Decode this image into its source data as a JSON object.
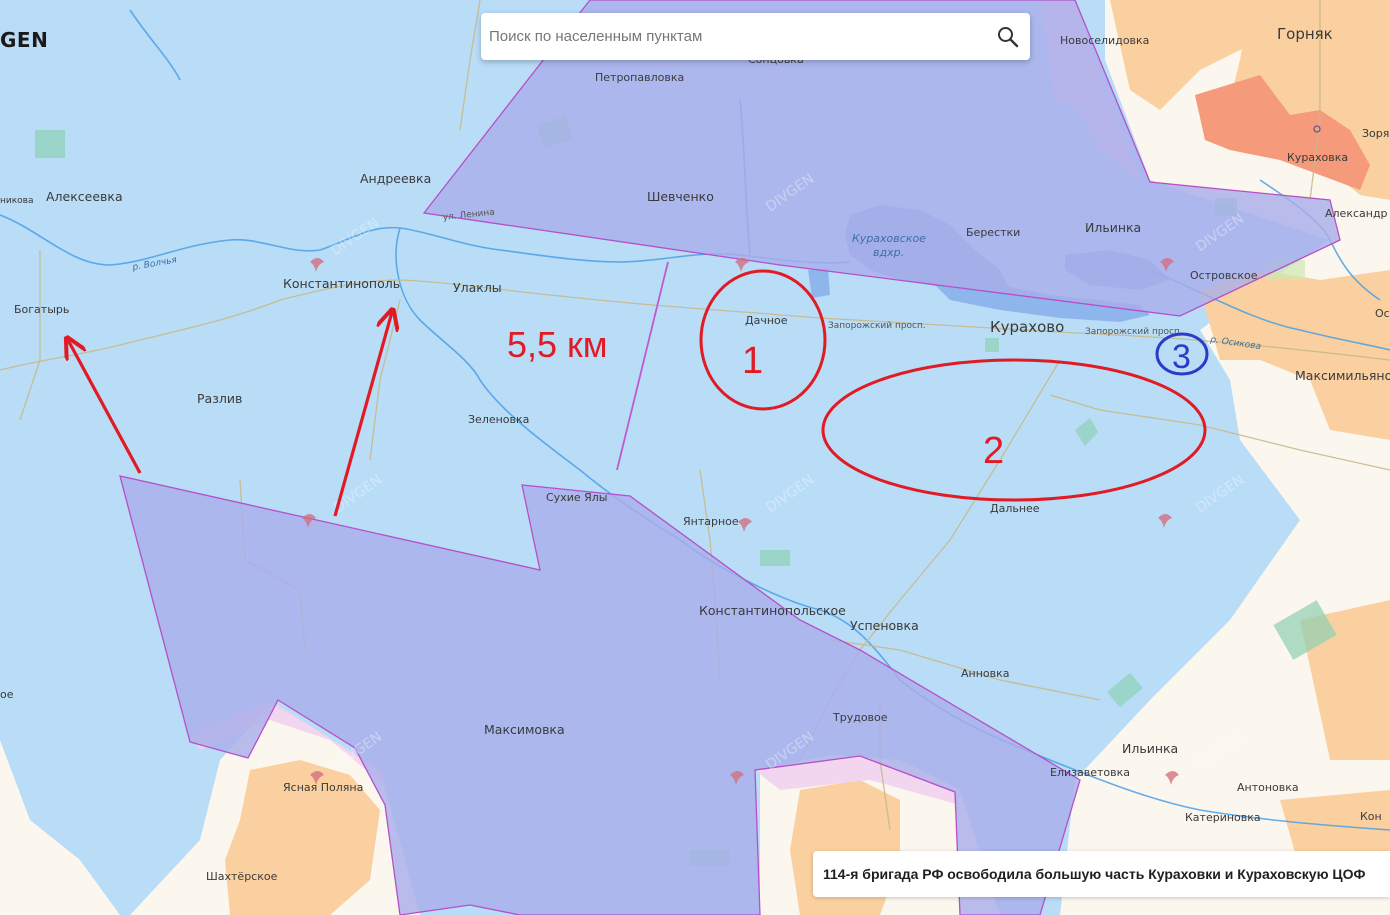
{
  "brand": {
    "logo_text": "GEN"
  },
  "search": {
    "placeholder": "Поиск по населенным пунктам",
    "icon": "search-icon"
  },
  "news": {
    "headline": "114-я бригада РФ освободила большую часть Кураховки и Кураховскую ЦОФ"
  },
  "annotations": {
    "distance": "5,5 км",
    "zone_1": "1",
    "zone_2": "2",
    "zone_3": "3",
    "annotation_color": "#e01b24",
    "marker_color": "#2a3dc9"
  },
  "colors": {
    "background_zone": "#b9dcf7",
    "occupied_zone": "#a9aeea",
    "border_line": "#b64fc9",
    "town_fill": "#fbd0a0",
    "contested_fill": "#f59a7a",
    "neutral_land": "#fbf6ee",
    "river": "#4aa0e6",
    "road": "#c8b98a"
  },
  "places": {
    "novoselidovka": "Новоселидовка",
    "gornyak": "Горняк",
    "sontsovka": "Сонцовка",
    "petropavlovka": "Петропавловка",
    "zorya": "Зоря",
    "kurakhovka": "Кураховка",
    "andreevka": "Андреевка",
    "shevchenko": "Шевченко",
    "alekseevka": "Алексеевка",
    "kurakhovskoe_res_1": "Кураховское",
    "kurakhovskoe_res_2": "вдхр.",
    "beresteki": "Берестки",
    "ilinka_n": "Ильинка",
    "aleksandropol": "Александр",
    "ul_lenina": "ул. Ленина",
    "r_volchya": "р. Волчья",
    "ostrovskoe": "Островское",
    "konstantinopol": "Константинополь",
    "ulakly": "Улаклы",
    "bogatyr": "Богатырь",
    "dachnoe": "Дачное",
    "zaporozhsky_1": "Запорожский просп.",
    "kurakhovo": "Курахово",
    "zaporozhsky_2": "Запорожский просп.",
    "r_osikova": "р. Осикова",
    "maksimilyanovka": "Максимильянов",
    "razliv": "Разлив",
    "zelenovka": "Зеленовка",
    "sukhie_yaly": "Сухие Ялы",
    "dalnee": "Дальнее",
    "yantarnoe": "Янтарное",
    "konstantinopolskoe": "Константинопольское",
    "uspenovka": "Успеновка",
    "annovka": "Анновка",
    "maksimovka": "Максимовка",
    "trudovoe": "Трудовое",
    "ilinka_s": "Ильинка",
    "elizavetovka": "Елизаветовка",
    "antonovka": "Антоновка",
    "yasnaya_polyana": "Ясная Поляна",
    "katerinovka": "Катериновка",
    "shakhterskoe": "Шахтёрское",
    "edge_kon": "Кон",
    "edge_nikova": "никова",
    "edge_oe": "ое",
    "edge_os": "Ос"
  },
  "watermark": {
    "text": "DIVGEN"
  }
}
